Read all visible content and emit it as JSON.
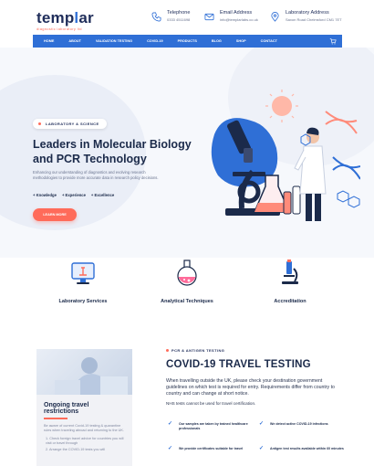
{
  "header": {
    "logo_text_a": "temp",
    "logo_text_i": "l",
    "logo_text_b": "ar",
    "logo_subtitle": "diagnostic laboratory ltd",
    "telephone_label": "Telephone",
    "telephone_value": "0333 4511698",
    "email_label": "Email Address",
    "email_value": "info@templarlabs.co.uk",
    "address_label": "Laboratory Address",
    "address_value": "Saxon Road Chelmsford CM1 7ET"
  },
  "nav": {
    "items": [
      "Home",
      "About",
      "Validation Testing",
      "Covid-19",
      "Products",
      "Blog",
      "Shop",
      "Contact"
    ],
    "cart_count": "0"
  },
  "hero": {
    "badge": "LABORATORY & SCIENCE",
    "title": "Leaders in Molecular Biology and PCR Technology",
    "description": "Enhancing our understanding of diagnostics and evolving research methodologies to provide more accurate data in research policy decisions.",
    "tags": [
      "+ Knowledge",
      "+ Experience",
      "+ Excellence"
    ],
    "button": "LEARN MORE"
  },
  "services": [
    {
      "label": "Laboratory Services",
      "icon": "microscope-monitor-icon"
    },
    {
      "label": "Analytical Techniques",
      "icon": "flask-icon"
    },
    {
      "label": "Accreditation",
      "icon": "microscope-icon"
    }
  ],
  "sidebar": {
    "title": "Ongoing travel restrictions",
    "text": "Be aware of current Covid-19 testing & quarantine rules when traveling abroad and returning to the UK.",
    "list": [
      "1. Check foreign travel advice for countries you will visit or travel through",
      "2. Arrange the COVID-19 tests you will"
    ]
  },
  "covid": {
    "tag": "PCR & ANTIGEN TESTING",
    "title": "COVID-19 TRAVEL TESTING",
    "text": "When travelling outside the UK, please check your destination government guidelines on which test is required for entry. Requirements differ from country to country and can change at short notice.",
    "note": "NHS tests cannot be used for travel certification.",
    "checks": [
      "Our samples are taken by trained healthcare professionals",
      "We detect active COVID-19 infections",
      "We provide certificates suitable for travel",
      "Antigen test results available within 60 minutes"
    ]
  },
  "colors": {
    "primary_blue": "#2f6fd6",
    "accent_coral": "#ff6b5a",
    "navy": "#1b2a4a"
  }
}
